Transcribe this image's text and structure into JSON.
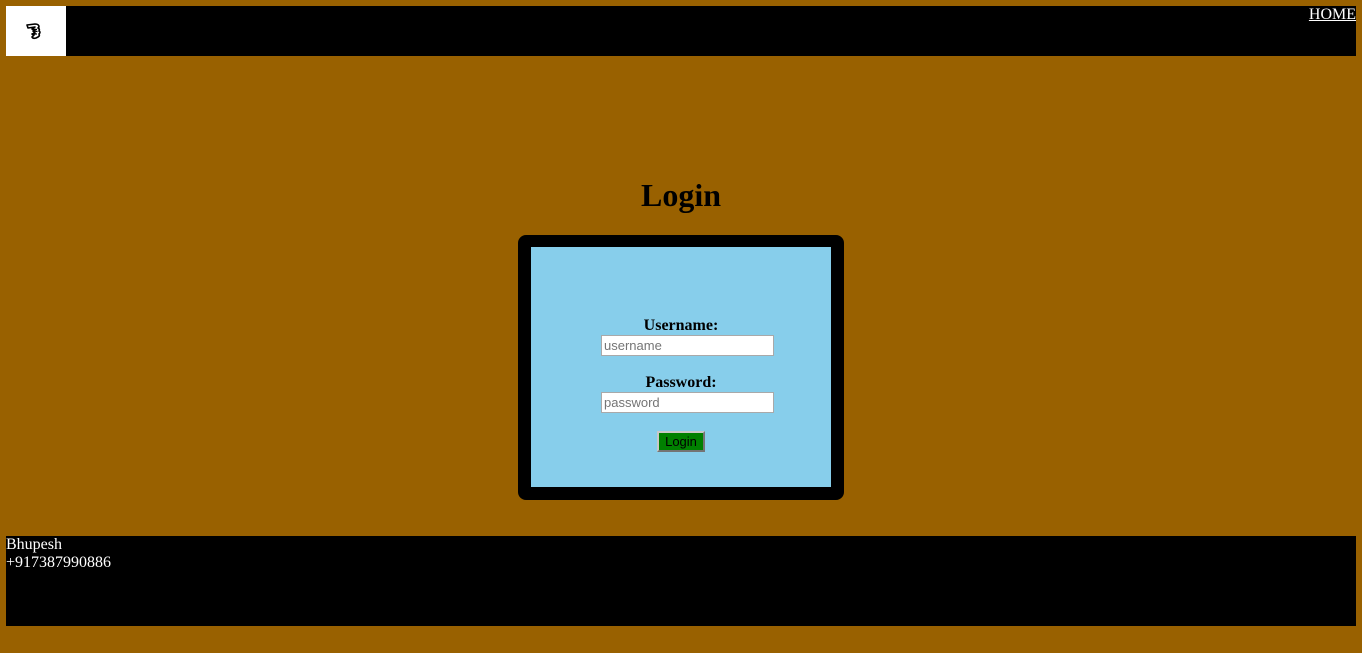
{
  "header": {
    "logo_icon": "hand-pointing-icon",
    "home_link": "HOME"
  },
  "main": {
    "title": "Login"
  },
  "form": {
    "username_label": "Username:",
    "username_placeholder": "username",
    "password_label": "Password:",
    "password_placeholder": "password",
    "submit_label": "Login"
  },
  "footer": {
    "name": "Bhupesh",
    "phone": "+917387990886"
  },
  "colors": {
    "page_background": "#996100",
    "bars": "#000000",
    "panel": "#87ceeb",
    "button": "#008000"
  }
}
